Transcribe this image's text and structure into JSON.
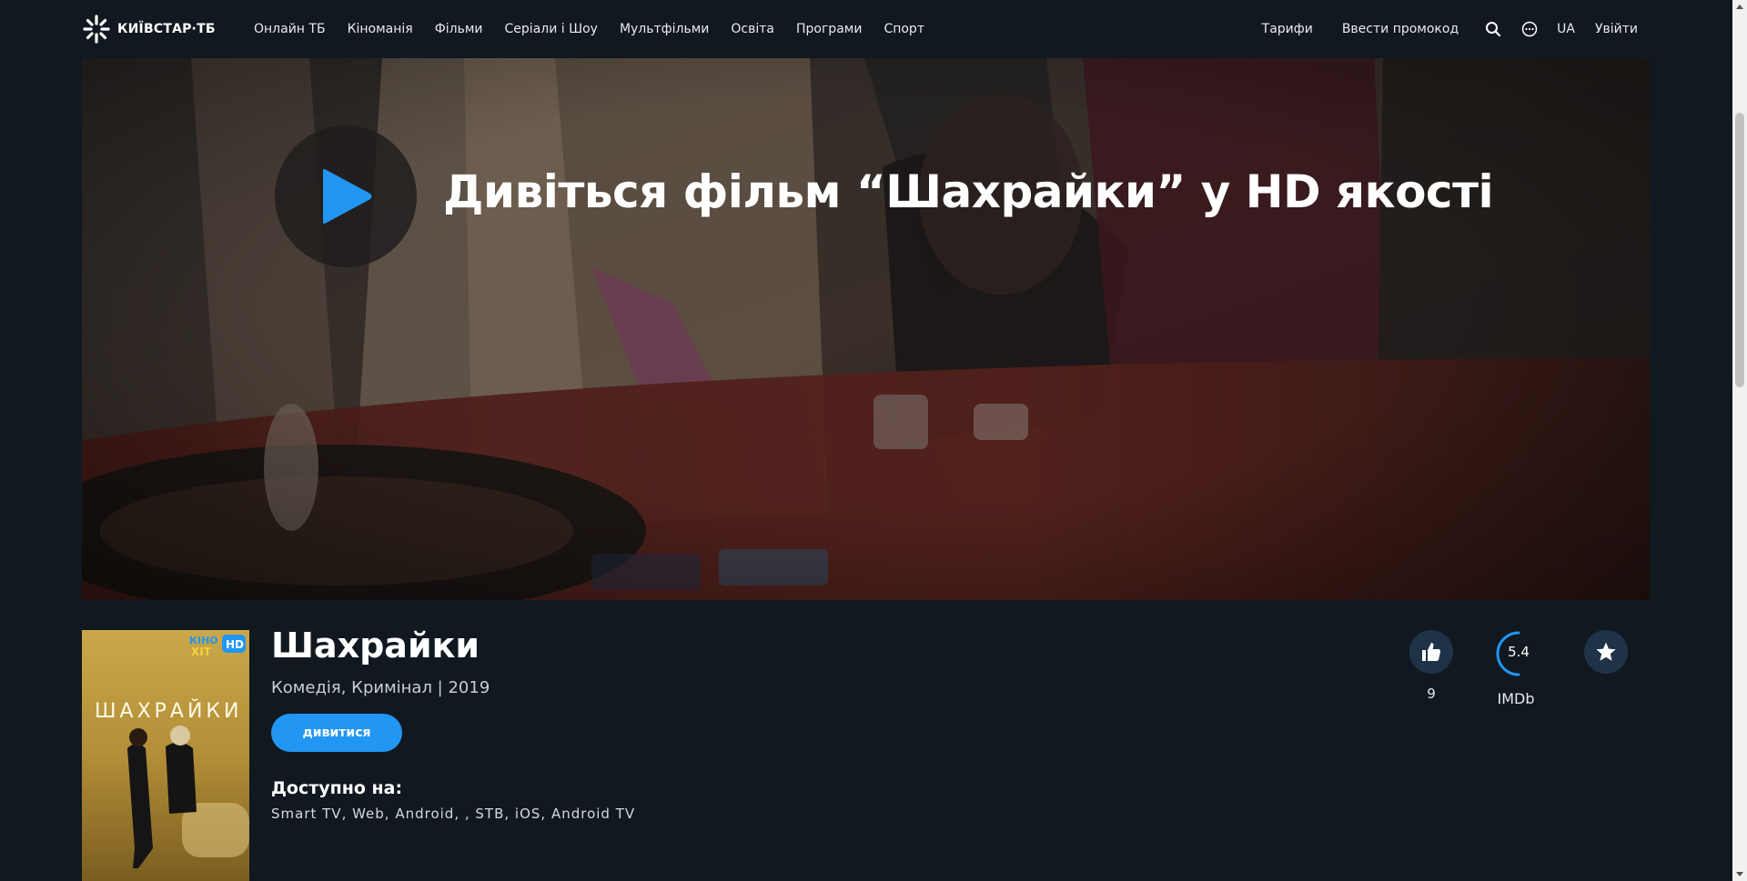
{
  "header": {
    "logo_text": "КИЇВСТАР·ТБ",
    "nav": [
      "Онлайн ТБ",
      "Кіноманія",
      "Фільми",
      "Серіали і Шоу",
      "Мультфільми",
      "Освіта",
      "Програми",
      "Спорт"
    ],
    "tariffs": "Тарифи",
    "promo": "Ввести промокод",
    "lang": "UA",
    "login": "Увійти"
  },
  "hero": {
    "title": "Дивіться фільм “Шахрайки” у HD якості"
  },
  "movie": {
    "title": "Шахрайки",
    "meta": "Комедія, Кримінал | 2019",
    "watch_label": "дивитися",
    "available_label": "Доступно на:",
    "platforms": "Smart TV, Web, Android, , STB, iOS, Android TV",
    "likes": "9",
    "imdb_score": "5.4",
    "imdb_label": "IMDb",
    "poster": {
      "badge_top": "КІНО",
      "badge_bottom": "ХІТ",
      "hd": "HD",
      "title": "ШАХРАЙКИ"
    }
  },
  "colors": {
    "background": "#111820",
    "accent": "#2196f3",
    "circle_button": "#1f3348"
  }
}
